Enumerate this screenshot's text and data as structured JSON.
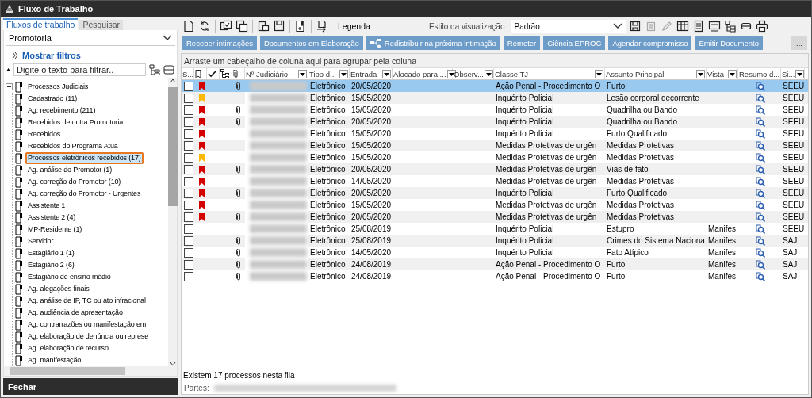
{
  "window": {
    "title": "Fluxo de Trabalho"
  },
  "sidebar": {
    "tabs": [
      {
        "label": "Fluxos de trabalho",
        "selected": true
      },
      {
        "label": "Pesquisar",
        "selected": false
      }
    ],
    "dropdown": {
      "value": "Promotoria"
    },
    "filters_link": "Mostrar filtros",
    "filter": {
      "placeholder": "Digite o texto para filtrar.."
    },
    "tree": [
      {
        "label": "Processos Judiciais",
        "expanded": true,
        "selected": false,
        "children": [
          {
            "label": "Cadastrado (11)",
            "selected": false
          },
          {
            "label": "Ag. recebimento (211)",
            "selected": false
          },
          {
            "label": "Recebidos de outra Promotoria",
            "selected": false
          },
          {
            "label": "Recebidos",
            "selected": false
          },
          {
            "label": "Recebidos do Programa Atua",
            "selected": false
          },
          {
            "label": "Processos eletrônicos recebidos (17)",
            "selected": true
          },
          {
            "label": "Ag. análise do Promotor (1)",
            "selected": false
          },
          {
            "label": "Ag. correção do Promotor (10)",
            "selected": false
          },
          {
            "label": "Ag. correção do Promotor - Urgentes",
            "selected": false
          },
          {
            "label": "Assistente 1",
            "selected": false
          },
          {
            "label": "Assistente 2 (4)",
            "selected": false
          },
          {
            "label": "MP-Residente (1)",
            "selected": false
          },
          {
            "label": "Servidor",
            "selected": false
          },
          {
            "label": "Estagiário 1 (1)",
            "selected": false
          },
          {
            "label": "Estagiário 2 (6)",
            "selected": false
          },
          {
            "label": "Estagiário de ensino médio",
            "selected": false
          },
          {
            "label": "Ag. alegações finais",
            "selected": false
          },
          {
            "label": "Ag. análise de IP, TC ou ato infracional",
            "selected": false
          },
          {
            "label": "Ag. audiência de apresentação",
            "selected": false
          },
          {
            "label": "Ag. contrarrazões ou manifestação em",
            "selected": false
          },
          {
            "label": "Ag. elaboração de denúncia ou represe",
            "selected": false
          },
          {
            "label": "Ag. elaboração de recurso",
            "selected": false
          },
          {
            "label": "Ag. manifestação",
            "selected": false
          }
        ]
      }
    ],
    "close_button": "Fechar"
  },
  "toolbar": {
    "legend": "Legenda",
    "view_style_label": "Estilo da visualização",
    "view_style": "Padrão"
  },
  "actions": [
    "Receber intimações",
    "Documentos em Elaboração",
    "Redistribuir na próxima intimação",
    "Remeter",
    "Ciência EPROC",
    "Agendar compromisso",
    "Emitir Documento",
    "..."
  ],
  "group_hint": "Arraste um cabeçalho de coluna aqui para agrupar pela coluna",
  "table": {
    "columns": [
      {
        "kind": "text",
        "label": "S...",
        "filter": false
      },
      {
        "kind": "flag"
      },
      {
        "kind": "check"
      },
      {
        "kind": "tree"
      },
      {
        "kind": "clip"
      },
      {
        "kind": "text",
        "label": "Nº Judiciário",
        "filter": true
      },
      {
        "kind": "text",
        "label": "Tipo d...",
        "filter": true
      },
      {
        "kind": "text",
        "label": "Entrada",
        "filter": true
      },
      {
        "kind": "text",
        "label": "Alocado para ...",
        "filter": true
      },
      {
        "kind": "text",
        "label": "Observ...",
        "filter": true
      },
      {
        "kind": "text",
        "label": "Classe TJ",
        "filter": true
      },
      {
        "kind": "text",
        "label": "Assunto Principal",
        "filter": true
      },
      {
        "kind": "text",
        "label": "Vista",
        "filter": true
      },
      {
        "kind": "text",
        "label": "Resumo d...",
        "filter": false
      },
      {
        "kind": "text",
        "label": "Si...",
        "filter": true
      }
    ],
    "rows": [
      {
        "selected": true,
        "checked": false,
        "color": "#d40000",
        "attachment": true,
        "tipo": "Eletrônico",
        "entrada": "20/05/2020",
        "classe": "Ação Penal - Procedimento O",
        "assunto": "Furto",
        "vista": "",
        "sistema": "SEEU"
      },
      {
        "selected": false,
        "checked": false,
        "color": "#ffb900",
        "attachment": false,
        "tipo": "Eletrônico",
        "entrada": "15/05/2020",
        "classe": "Inquérito Policial",
        "assunto": "Lesão corporal decorrente",
        "vista": "",
        "sistema": "SEEU"
      },
      {
        "selected": false,
        "checked": false,
        "color": "#d40000",
        "attachment": true,
        "tipo": "Eletrônico",
        "entrada": "15/05/2020",
        "classe": "Inquérito Policial",
        "assunto": "Quadrilha ou Bando",
        "vista": "",
        "sistema": "SEEU"
      },
      {
        "selected": false,
        "checked": false,
        "color": "#d40000",
        "attachment": true,
        "tipo": "Eletrônico",
        "entrada": "20/05/2020",
        "classe": "Inquérito Policial",
        "assunto": "Quadrilha ou Bando",
        "vista": "",
        "sistema": "SEEU"
      },
      {
        "selected": false,
        "checked": false,
        "color": "#d40000",
        "attachment": false,
        "tipo": "Eletrônico",
        "entrada": "15/05/2020",
        "classe": "Inquérito Policial",
        "assunto": "Furto Qualificado",
        "vista": "",
        "sistema": "SEEU"
      },
      {
        "selected": false,
        "checked": false,
        "color": "#d40000",
        "attachment": false,
        "tipo": "Eletrônico",
        "entrada": "15/05/2020",
        "classe": "Medidas Protetivas de urgên",
        "assunto": "Medidas Protetivas",
        "vista": "",
        "sistema": "SEEU"
      },
      {
        "selected": false,
        "checked": false,
        "color": "#ffb900",
        "attachment": false,
        "tipo": "Eletrônico",
        "entrada": "15/05/2020",
        "classe": "Medidas Protetivas de urgên",
        "assunto": "Medidas Protetivas",
        "vista": "",
        "sistema": "SEEU"
      },
      {
        "selected": false,
        "checked": false,
        "color": "#d40000",
        "attachment": true,
        "tipo": "Eletrônico",
        "entrada": "20/05/2020",
        "classe": "Medidas Protetivas de urgên",
        "assunto": "Vias de fato",
        "vista": "",
        "sistema": "SEEU"
      },
      {
        "selected": false,
        "checked": false,
        "color": "#d40000",
        "attachment": false,
        "tipo": "Eletrônico",
        "entrada": "14/05/2020",
        "classe": "Medidas Protetivas de urgên",
        "assunto": "Medidas Protetivas",
        "vista": "",
        "sistema": "SEEU"
      },
      {
        "selected": false,
        "checked": false,
        "color": "#d40000",
        "attachment": true,
        "tipo": "Eletrônico",
        "entrada": "20/05/2020",
        "classe": "Inquérito Policial",
        "assunto": "Furto Qualificado",
        "vista": "",
        "sistema": "SEEU"
      },
      {
        "selected": false,
        "checked": false,
        "color": "#d40000",
        "attachment": false,
        "tipo": "Eletrônico",
        "entrada": "15/05/2020",
        "classe": "Medidas Protetivas de urgên",
        "assunto": "Medidas Protetivas",
        "vista": "",
        "sistema": "SEEU"
      },
      {
        "selected": false,
        "checked": false,
        "color": "#d40000",
        "attachment": true,
        "tipo": "Eletrônico",
        "entrada": "20/05/2020",
        "classe": "Medidas Protetivas de urgên",
        "assunto": "Medidas Protetivas",
        "vista": "",
        "sistema": "SEEU"
      },
      {
        "selected": false,
        "checked": false,
        "attachment": false,
        "tipo": "Eletrônico",
        "entrada": "25/08/2019",
        "classe": "Inquérito Policial",
        "assunto": "Estupro",
        "vista": "Manifes",
        "sistema": "SEEU"
      },
      {
        "selected": false,
        "checked": false,
        "attachment": true,
        "tipo": "Eletrônico",
        "entrada": "25/08/2019",
        "classe": "Inquérito Policial",
        "assunto": "Crimes do Sistema Naciona",
        "vista": "Manifes",
        "sistema": "SAJ"
      },
      {
        "selected": false,
        "checked": false,
        "attachment": true,
        "tipo": "Eletrônico",
        "entrada": "14/05/2020",
        "classe": "Inquérito Policial",
        "assunto": "Fato Atípico",
        "vista": "Manifes",
        "sistema": "SAJ"
      },
      {
        "selected": false,
        "checked": false,
        "attachment": true,
        "tipo": "Eletrônico",
        "entrada": "24/08/2019",
        "classe": "Ação Penal - Procedimento O",
        "assunto": "Furto",
        "vista": "Manifes",
        "sistema": "SAJ"
      },
      {
        "selected": false,
        "checked": false,
        "attachment": true,
        "tipo": "Eletrônico",
        "entrada": "24/08/2019",
        "classe": "Ação Penal - Procedimento O",
        "assunto": "Furto",
        "vista": "Manifes",
        "sistema": "SAJ"
      }
    ]
  },
  "status_bar": {
    "count": "Existem 17 processos nesta fila",
    "parties_label": "Partes:"
  }
}
